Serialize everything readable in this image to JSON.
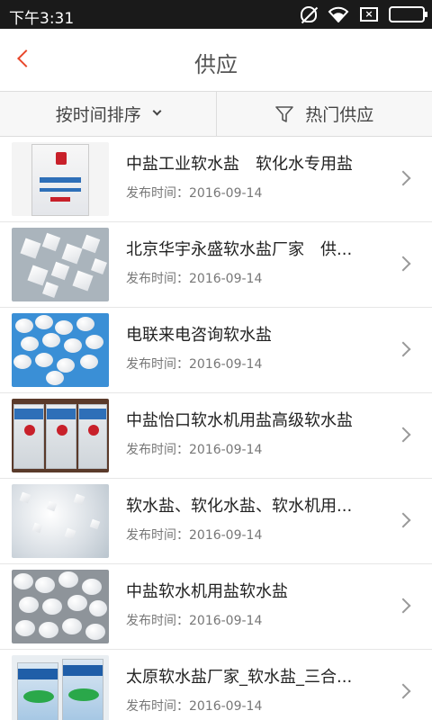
{
  "status_bar": {
    "time": "下午3:31"
  },
  "header": {
    "title": "供应"
  },
  "filters": {
    "sort_label": "按时间排序",
    "hot_label": "热门供应"
  },
  "items": [
    {
      "title": "中盐工业软水盐　软化水专用盐",
      "date": "发布时间：2016-09-14"
    },
    {
      "title": "北京华宇永盛软水盐厂家　供...",
      "date": "发布时间：2016-09-14"
    },
    {
      "title": "电联来电咨询软水盐",
      "date": "发布时间：2016-09-14"
    },
    {
      "title": "中盐怡口软水机用盐高级软水盐",
      "date": "发布时间：2016-09-14"
    },
    {
      "title": "软水盐、软化水盐、软水机用...",
      "date": "发布时间：2016-09-14"
    },
    {
      "title": "中盐软水机用盐软水盐",
      "date": "发布时间：2016-09-14"
    },
    {
      "title": "太原软水盐厂家_软水盐_三合...",
      "date": "发布时间：2016-09-14"
    }
  ]
}
